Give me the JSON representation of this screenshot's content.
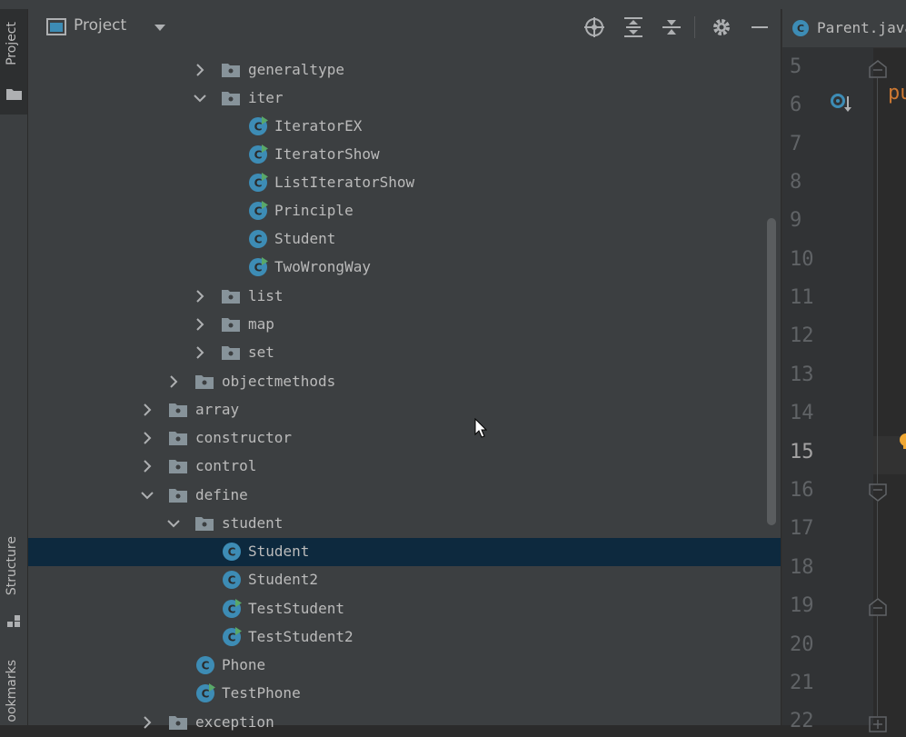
{
  "window": {
    "tool_window_title": "Project"
  },
  "left_strip": {
    "project_tab": "Project",
    "structure_tab": "Structure",
    "bookmarks_tab": "ookmarks"
  },
  "tree": [
    {
      "label": "generaltype",
      "type": "folder",
      "expanded": false
    },
    {
      "label": "iter",
      "type": "folder",
      "expanded": true
    },
    {
      "label": "IteratorEX",
      "type": "class",
      "runnable": true
    },
    {
      "label": "IteratorShow",
      "type": "class",
      "runnable": true
    },
    {
      "label": "ListIteratorShow",
      "type": "class",
      "runnable": true
    },
    {
      "label": "Principle",
      "type": "class",
      "runnable": true
    },
    {
      "label": "Student",
      "type": "class",
      "runnable": false
    },
    {
      "label": "TwoWrongWay",
      "type": "class",
      "runnable": true
    },
    {
      "label": "list",
      "type": "folder",
      "expanded": false
    },
    {
      "label": "map",
      "type": "folder",
      "expanded": false
    },
    {
      "label": "set",
      "type": "folder",
      "expanded": false
    },
    {
      "label": "objectmethods",
      "type": "folder",
      "expanded": false
    },
    {
      "label": "array",
      "type": "folder",
      "expanded": false
    },
    {
      "label": "constructor",
      "type": "folder",
      "expanded": false
    },
    {
      "label": "control",
      "type": "folder",
      "expanded": false
    },
    {
      "label": "define",
      "type": "folder",
      "expanded": true
    },
    {
      "label": "student",
      "type": "folder",
      "expanded": true
    },
    {
      "label": "Student",
      "type": "class",
      "runnable": false,
      "selected": true
    },
    {
      "label": "Student2",
      "type": "class",
      "runnable": false
    },
    {
      "label": "TestStudent",
      "type": "class",
      "runnable": true
    },
    {
      "label": "TestStudent2",
      "type": "class",
      "runnable": true
    },
    {
      "label": "Phone",
      "type": "class",
      "runnable": false
    },
    {
      "label": "TestPhone",
      "type": "class",
      "runnable": true
    },
    {
      "label": "exception",
      "type": "folder",
      "expanded": false
    }
  ],
  "editor": {
    "tab_label": "Parent.java",
    "line_numbers": [
      "5",
      "6",
      "7",
      "8",
      "9",
      "10",
      "11",
      "12",
      "13",
      "14",
      "15",
      "16",
      "17",
      "18",
      "19",
      "20",
      "21",
      "22"
    ],
    "current_line": "15",
    "code_fragment": "pu"
  },
  "colors": {
    "panel_bg": "#3c3f41",
    "editor_bg": "#2b2b2b",
    "selection": "#0d293e",
    "class_icon": "#3d8cb5",
    "keyword": "#cc7832"
  }
}
